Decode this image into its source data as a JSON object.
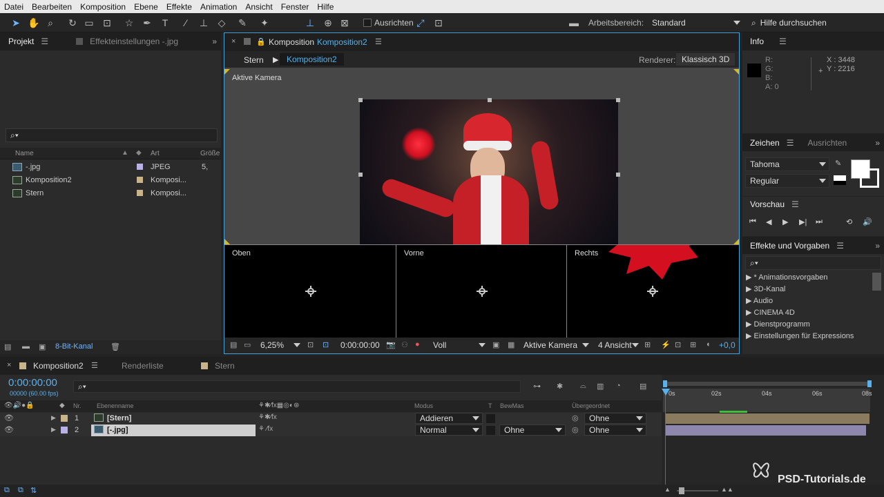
{
  "menu": [
    "Datei",
    "Bearbeiten",
    "Komposition",
    "Ebene",
    "Effekte",
    "Animation",
    "Ansicht",
    "Fenster",
    "Hilfe"
  ],
  "toolbar": {
    "align_label": "Ausrichten",
    "workspace_label": "Arbeitsbereich:",
    "workspace_value": "Standard",
    "help_placeholder": "Hilfe durchsuchen"
  },
  "project": {
    "tab": "Projekt",
    "tab2": "Effekteinstellungen -.jpg",
    "columns": {
      "name": "Name",
      "type": "Art",
      "size": "Größe"
    },
    "items": [
      {
        "name": "-.jpg",
        "type": "JPEG",
        "size": "5,",
        "color": "#b9b2e6"
      },
      {
        "name": "Komposition2",
        "type": "Komposi...",
        "size": "",
        "color": "#c9b38a"
      },
      {
        "name": "Stern",
        "type": "Komposi...",
        "size": "",
        "color": "#c9b38a"
      }
    ],
    "bitdepth": "8-Bit-Kanal"
  },
  "comp": {
    "header_prefix": "Komposition",
    "header_name": "Komposition2",
    "breadcrumb": [
      "Stern",
      "Komposition2"
    ],
    "renderer_label": "Renderer:",
    "renderer_value": "Klassisch 3D",
    "main_view": "Aktive Kamera",
    "views": [
      "Oben",
      "Vorne",
      "Rechts"
    ],
    "footer": {
      "zoom": "6,25%",
      "time": "0:00:00:00",
      "resolution": "Voll",
      "camera": "Aktive Kamera",
      "layout": "4 Ansicht",
      "exposure": "+0,0"
    }
  },
  "info": {
    "title": "Info",
    "r": "R:",
    "g": "G:",
    "b": "B:",
    "a": "A:  0",
    "x": "X : 3448",
    "y": "Y : 2216"
  },
  "character": {
    "tab": "Zeichen",
    "tab2": "Ausrichten",
    "font": "Tahoma",
    "style": "Regular"
  },
  "preview": {
    "title": "Vorschau"
  },
  "effects": {
    "title": "Effekte und Vorgaben",
    "items": [
      "* Animationsvorgaben",
      "3D-Kanal",
      "Audio",
      "CINEMA 4D",
      "Dienstprogramm",
      "Einstellungen für Expressions"
    ]
  },
  "timeline": {
    "tabs": [
      "Komposition2",
      "Renderliste",
      "Stern"
    ],
    "timecode": "0:00:00:00",
    "fps": "00000 (60.00 fps)",
    "columns": {
      "nr": "Nr.",
      "name": "Ebenenname",
      "mode": "Modus",
      "t": "T",
      "trkmat": "BewMas",
      "parent": "Übergeordnet"
    },
    "layers": [
      {
        "nr": "1",
        "name": "[Stern]",
        "mode": "Addieren",
        "trkmat": "",
        "parent": "Ohne",
        "color": "#c9b38a"
      },
      {
        "nr": "2",
        "name": "[-.jpg]",
        "mode": "Normal",
        "trkmat": "Ohne",
        "parent": "Ohne",
        "color": "#b9b2e6"
      }
    ],
    "ruler": [
      "0s",
      "02s",
      "04s",
      "06s",
      "08s"
    ]
  },
  "watermark": "PSD-Tutorials.de"
}
